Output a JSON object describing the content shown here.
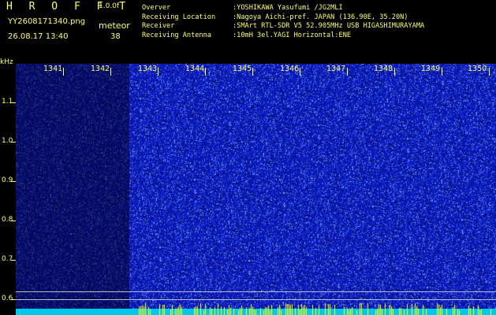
{
  "header": {
    "app_title": "H R O F F T",
    "app_version": "1.0.0f",
    "file_name": "YY2608171340.png",
    "timestamp": "26.08.17 13:40",
    "mode_label": "meteor",
    "count_value": "38"
  },
  "info": [
    {
      "key": "Overver",
      "value": ":YOSHIKAWA Yasufumi /JG2MLI"
    },
    {
      "key": "Receiving Location",
      "value": ":Nagoya Aichi-pref. JAPAN (136.90E, 35.20N)"
    },
    {
      "key": "Receiver",
      "value": ":SMArt RTL-SDR V5 52.905MHz USB HIGASHIMURAYAMA"
    },
    {
      "key": "Receiving Antenna",
      "value": ":10mH 3el.YAGI Horizontal:ENE"
    }
  ],
  "spectrogram": {
    "y_unit": "kHz",
    "y_ticks": [
      "1.1",
      "1.0",
      "0.9",
      "0.8",
      "0.7",
      "0.6"
    ],
    "x_ticks": [
      "1341",
      "1342",
      "1343",
      "1344",
      "1345",
      "1346",
      "1347",
      "1348",
      "1349",
      "1350"
    ],
    "colors": {
      "background": "#000000",
      "text": "#ffff66",
      "noise_base": "#0a1aa8",
      "noise_bright": "#5f7fff",
      "bottom_strip": "#00c8e8",
      "bottom_bars": "#ffff00"
    }
  }
}
